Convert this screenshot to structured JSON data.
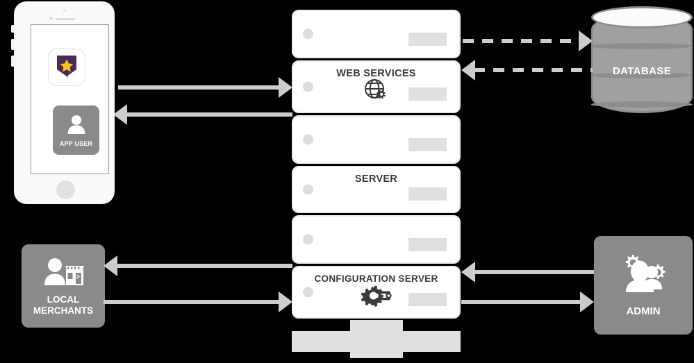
{
  "diagram": {
    "title": "System Architecture Diagram",
    "background_color": "#000000",
    "accent_gray": "#8a8a8a",
    "arrow_color": "#cccccc"
  },
  "phone": {
    "name": "mobile-device",
    "app_icon": {
      "icon": "shield-star-badge-icon",
      "shield_color": "#4a2b54",
      "star_color": "#f5c022"
    },
    "user_tile": {
      "label": "APP USER",
      "icon": "user-avatar-icon"
    }
  },
  "server_rack": {
    "bays": [
      {
        "title": "",
        "icon": "",
        "height": 70
      },
      {
        "title": "WEB SERVICES",
        "icon": "globe-gear-icon",
        "height": 76
      },
      {
        "title": "",
        "icon": "",
        "height": 70
      },
      {
        "title": "SERVER",
        "icon": "",
        "height": 68
      },
      {
        "title": "",
        "icon": "",
        "height": 70
      },
      {
        "title": "CONFIGURATION SERVER",
        "icon": "gear-wrench-icon",
        "height": 76
      }
    ]
  },
  "database": {
    "label": "DATABASE",
    "icon": "cylinder-database-icon",
    "fill_color": "#a0a0a0",
    "stroke_color": "#8e8e8e"
  },
  "local_merchants": {
    "label": "LOCAL\nMERCHANTS",
    "label_line1": "LOCAL",
    "label_line2": "MERCHANTS",
    "icon": "person-storefront-icon"
  },
  "admin": {
    "label": "ADMIN",
    "icon": "people-gears-icon"
  },
  "connections": [
    {
      "id": "phone-to-server",
      "from": "mobile-device",
      "to": "server-rack",
      "direction": "right",
      "style": "solid"
    },
    {
      "id": "server-to-phone",
      "from": "server-rack",
      "to": "mobile-device",
      "direction": "left",
      "style": "solid"
    },
    {
      "id": "server-to-database",
      "from": "server-rack",
      "to": "database",
      "direction": "right",
      "style": "dashed"
    },
    {
      "id": "database-to-server",
      "from": "database",
      "to": "server-rack",
      "direction": "left",
      "style": "dashed"
    },
    {
      "id": "server-to-merchants",
      "from": "server-rack",
      "to": "local-merchants",
      "direction": "left",
      "style": "solid"
    },
    {
      "id": "merchants-to-server",
      "from": "local-merchants",
      "to": "server-rack",
      "direction": "right",
      "style": "solid"
    },
    {
      "id": "admin-to-server",
      "from": "admin",
      "to": "server-rack",
      "direction": "left",
      "style": "solid"
    },
    {
      "id": "server-to-admin",
      "from": "server-rack",
      "to": "admin",
      "direction": "right",
      "style": "solid"
    }
  ]
}
